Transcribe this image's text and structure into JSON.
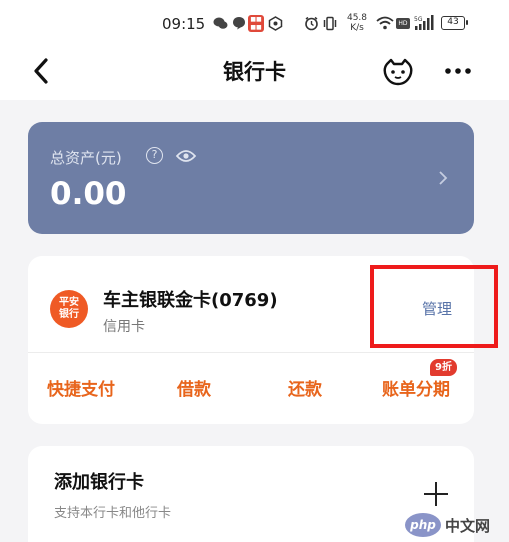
{
  "status_bar": {
    "time": "09:15",
    "speed_value": "45.8",
    "speed_unit": "K/s",
    "network": "HD",
    "signal": "5G",
    "battery": "43"
  },
  "nav": {
    "title": "银行卡"
  },
  "asset": {
    "label": "总资产(元)",
    "value": "0.00"
  },
  "credit_card": {
    "bank_logo_line1": "平安",
    "bank_logo_line2": "银行",
    "name": "车主银联金卡(0769)",
    "type": "信用卡",
    "manage_label": "管理",
    "actions": [
      {
        "label": "快捷支付"
      },
      {
        "label": "借款"
      },
      {
        "label": "还款"
      },
      {
        "label": "账单分期",
        "badge": "9折"
      }
    ]
  },
  "add_card": {
    "title": "添加银行卡",
    "subtitle": "支持本行卡和他行卡"
  },
  "watermark": {
    "logo": "php",
    "text": "中文网"
  },
  "colors": {
    "asset_card": "#6e7ea5",
    "action_orange": "#e8651c",
    "manage_blue": "#5873a8",
    "highlight_red": "#ee1b1b",
    "bank_logo": "#ef5a25"
  }
}
